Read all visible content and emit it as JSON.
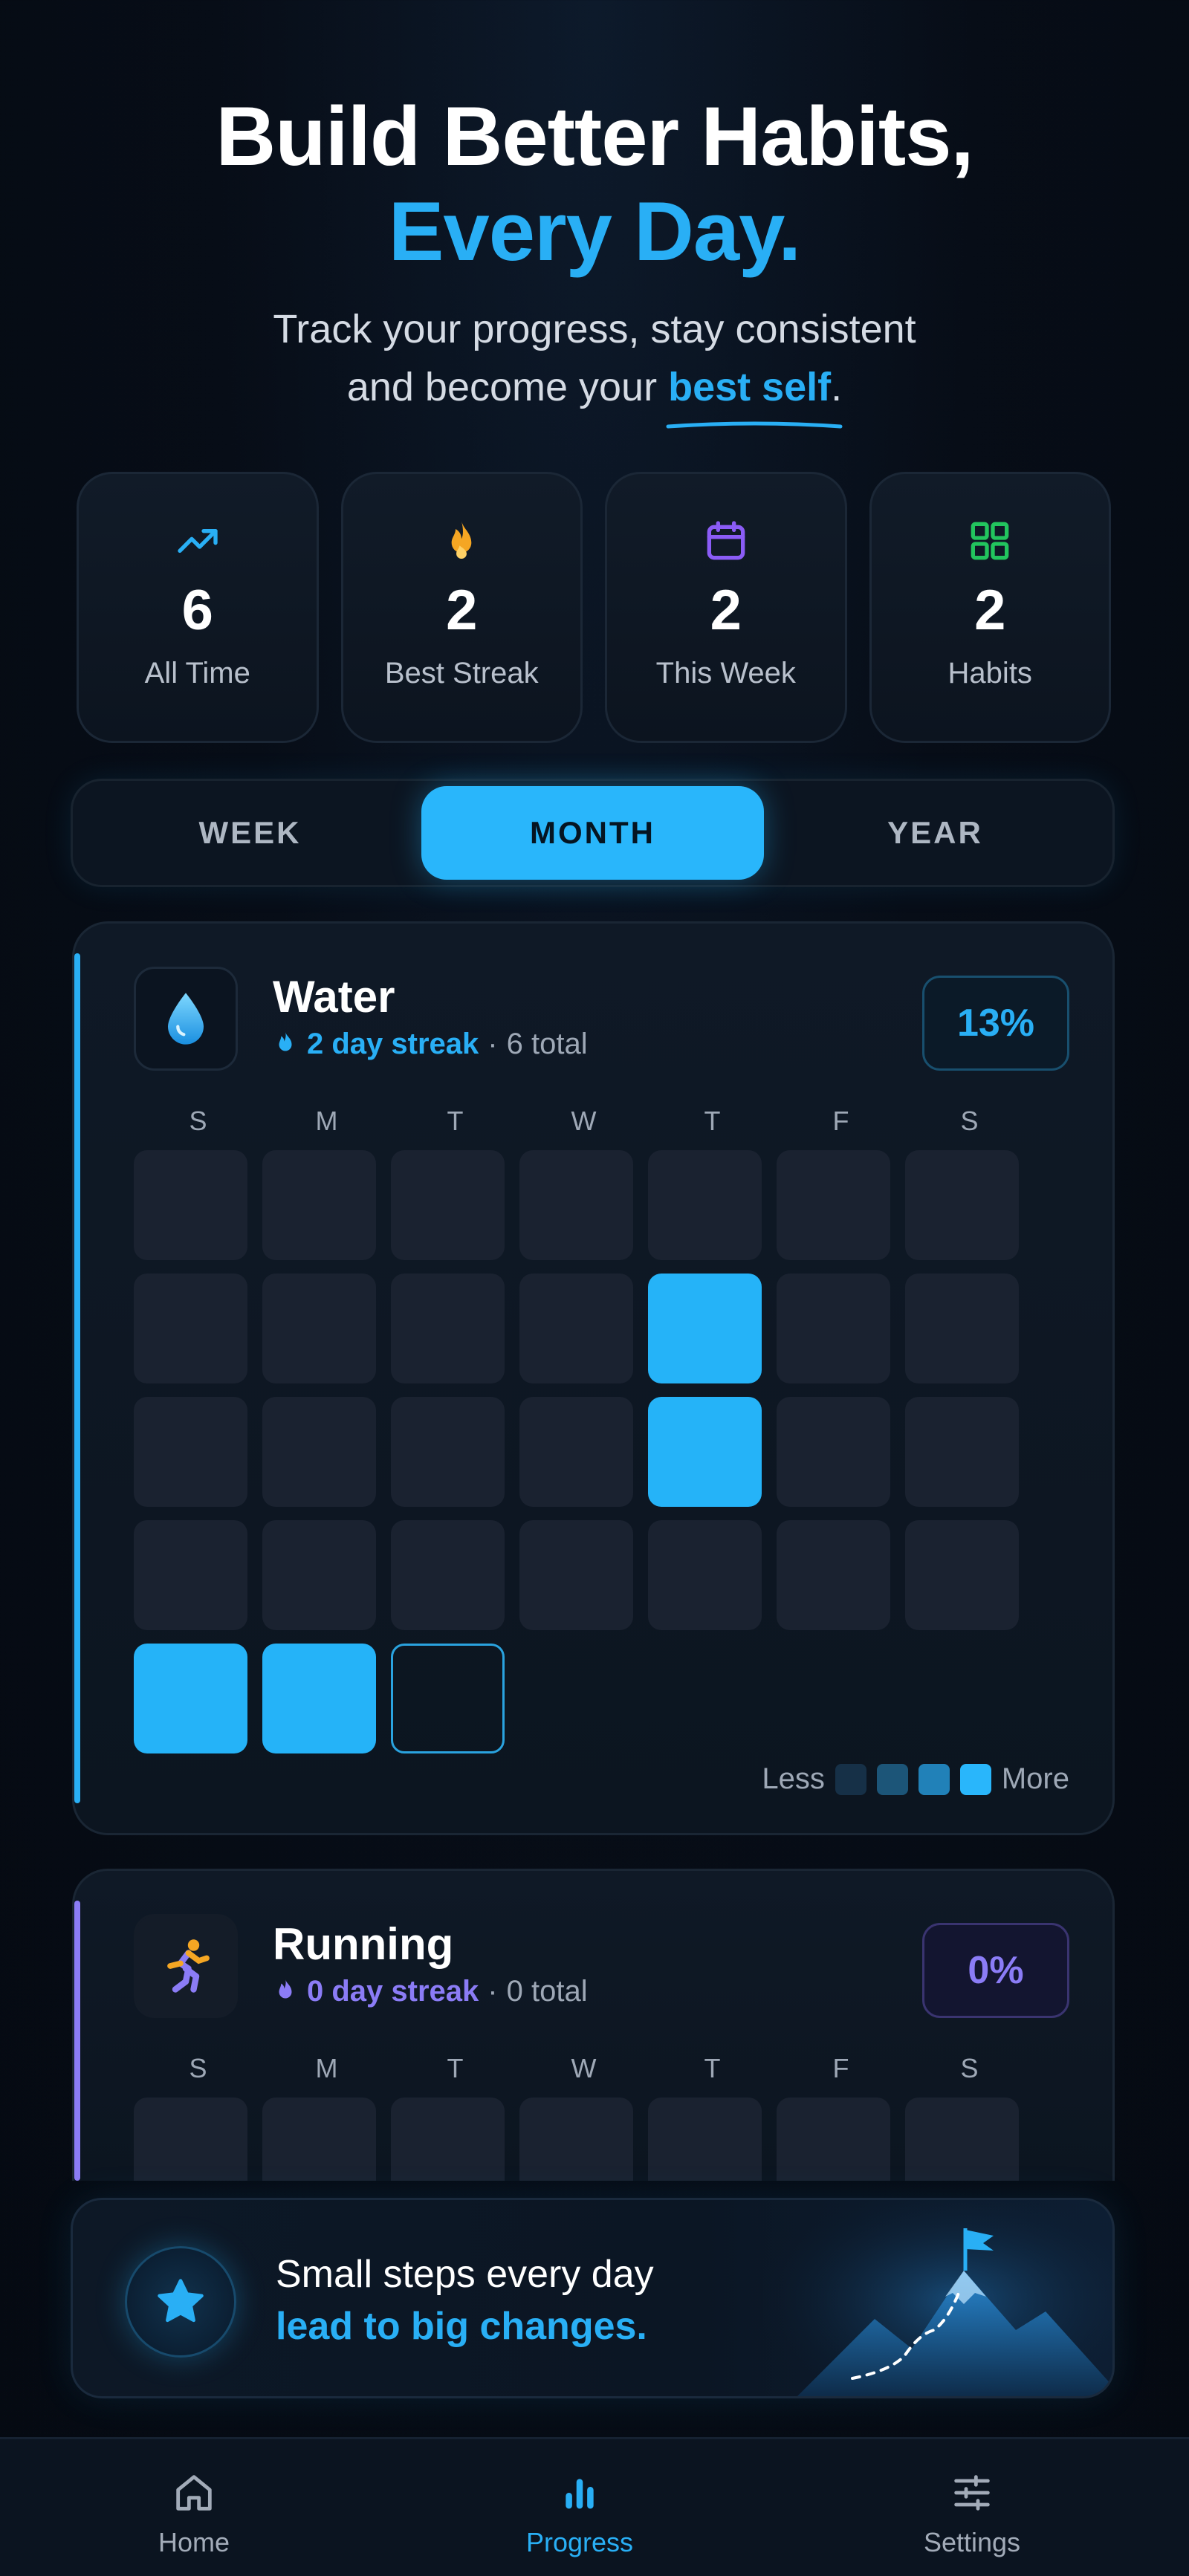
{
  "hero": {
    "title_line1": "Build Better Habits,",
    "title_line2": "Every Day.",
    "subtitle_part1": "Track your progress, stay consistent",
    "subtitle_part2": "and become your ",
    "subtitle_highlight": "best self",
    "subtitle_end": "."
  },
  "stats": [
    {
      "icon": "trending-up-icon",
      "value": "6",
      "label": "All Time",
      "color": "#29aff5"
    },
    {
      "icon": "flame-icon",
      "value": "2",
      "label": "Best Streak",
      "color": "#f5a623"
    },
    {
      "icon": "calendar-icon",
      "value": "2",
      "label": "This Week",
      "color": "#8b5cf6"
    },
    {
      "icon": "grid-icon",
      "value": "2",
      "label": "Habits",
      "color": "#22c55e"
    }
  ],
  "segments": {
    "week": "WEEK",
    "month": "MONTH",
    "year": "YEAR",
    "selected": "MONTH"
  },
  "habits": [
    {
      "name": "Water",
      "icon": "water-drop-icon",
      "streak": "2 day streak",
      "separator": "·",
      "total": "6 total",
      "percent": "13%",
      "accent": "#29aff5",
      "weekdays": [
        "S",
        "M",
        "T",
        "W",
        "T",
        "F",
        "S"
      ],
      "completed_days": [
        11,
        18,
        28,
        29
      ],
      "today": 30,
      "legend_less": "Less",
      "legend_more": "More"
    },
    {
      "name": "Running",
      "icon": "running-person-icon",
      "streak": "0 day streak",
      "separator": "·",
      "total": "0 total",
      "percent": "0%",
      "accent": "#8b7cf6",
      "weekdays": [
        "S",
        "M",
        "T",
        "W",
        "T",
        "F",
        "S"
      ]
    }
  ],
  "quote": {
    "line1": "Small steps every day",
    "line2": "lead to big changes.",
    "icon": "star-icon"
  },
  "tabbar": [
    {
      "label": "Home",
      "icon": "home-icon"
    },
    {
      "label": "Progress",
      "icon": "bar-chart-icon",
      "active": true
    },
    {
      "label": "Settings",
      "icon": "sliders-icon"
    }
  ]
}
